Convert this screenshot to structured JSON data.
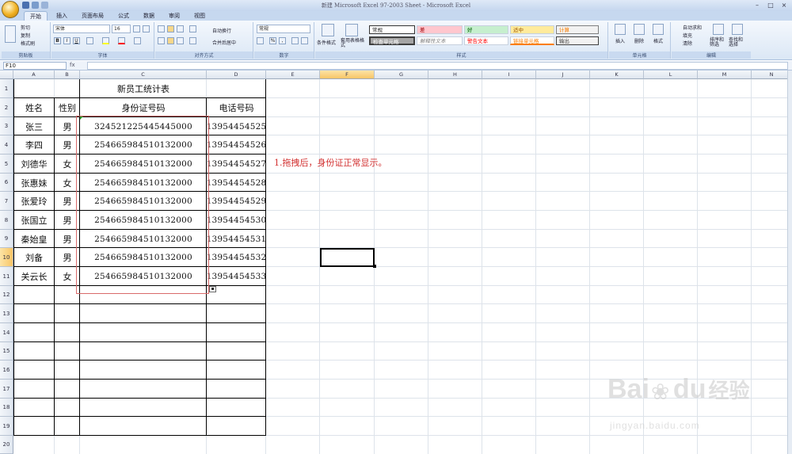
{
  "window": {
    "title": "新建 Microsoft Excel 97-2003 Sheet - Microsoft Excel",
    "controls": [
      "–",
      "□",
      "×"
    ]
  },
  "tabs": [
    "开始",
    "插入",
    "页面布局",
    "公式",
    "数据",
    "审阅",
    "视图"
  ],
  "ribbon": {
    "clipboard": {
      "label": "剪贴板",
      "cut": "剪切",
      "copy": "复制",
      "format_painter": "格式刷"
    },
    "font": {
      "label": "字体",
      "font_name": "宋体",
      "font_size": "16",
      "bold": "B",
      "italic": "I",
      "underline": "U"
    },
    "alignment": {
      "label": "对齐方式",
      "wrap": "自动换行",
      "merge": "合并后居中"
    },
    "number": {
      "label": "数字",
      "format": "常规",
      "percent": "%",
      "comma": ","
    },
    "styles": {
      "label": "样式",
      "conditional": "条件格式",
      "table_format": "套用表格格式",
      "cells": [
        {
          "text": "常规",
          "bg": "#ffffff",
          "color": "#000000"
        },
        {
          "text": "差",
          "bg": "#ffc7ce",
          "color": "#9c0006"
        },
        {
          "text": "好",
          "bg": "#c6efce",
          "color": "#006100"
        },
        {
          "text": "适中",
          "bg": "#ffeb9c",
          "color": "#9c5700"
        },
        {
          "text": "计算",
          "bg": "#f2f2f2",
          "color": "#fa7d00"
        },
        {
          "text": "检查单元格",
          "bg": "#a5a5a5",
          "color": "#ffffff"
        },
        {
          "text": "解释性文本",
          "bg": "#ffffff",
          "color": "#7f7f7f"
        },
        {
          "text": "警告文本",
          "bg": "#ffffff",
          "color": "#ff0000"
        },
        {
          "text": "链接单元格",
          "bg": "#ffffff",
          "color": "#fa7d00"
        },
        {
          "text": "输出",
          "bg": "#f2f2f2",
          "color": "#3f3f3f"
        }
      ]
    },
    "cells_group": {
      "label": "单元格",
      "insert": "插入",
      "delete": "删除",
      "format": "格式"
    },
    "editing": {
      "label": "编辑",
      "autosum": "自动求和",
      "fill": "填充",
      "clear": "清除",
      "sort": "排序和筛选",
      "find": "查找和选择"
    }
  },
  "formula_bar": {
    "name_box": "F10",
    "fx": "fx",
    "content": ""
  },
  "columns": [
    "A",
    "B",
    "C",
    "D",
    "E",
    "F",
    "G",
    "H",
    "I",
    "J",
    "K",
    "L",
    "M",
    "N"
  ],
  "selected_column": "F",
  "rows": [
    "1",
    "2",
    "3",
    "4",
    "5",
    "6",
    "7",
    "8",
    "9",
    "10",
    "11",
    "12",
    "13",
    "14",
    "15",
    "16",
    "17",
    "18",
    "19",
    "20"
  ],
  "selected_row": "10",
  "sheet": {
    "title": "新员工统计表",
    "headers": [
      "姓名",
      "性别",
      "身份证号码",
      "电话号码"
    ],
    "records": [
      [
        "张三",
        "男",
        "324521225445445000",
        "13954454525"
      ],
      [
        "李四",
        "男",
        "254665984510132000",
        "13954454526"
      ],
      [
        "刘德华",
        "女",
        "254665984510132000",
        "13954454527"
      ],
      [
        "张惠妹",
        "女",
        "254665984510132000",
        "13954454528"
      ],
      [
        "张爱玲",
        "男",
        "254665984510132000",
        "13954454529"
      ],
      [
        "张国立",
        "男",
        "254665984510132000",
        "13954454530"
      ],
      [
        "秦始皇",
        "男",
        "254665984510132000",
        "13954454531"
      ],
      [
        "刘备",
        "男",
        "254665984510132000",
        "13954454532"
      ],
      [
        "关云长",
        "女",
        "254665984510132000",
        "13954454533"
      ]
    ],
    "note": "1.拖拽后，身份证正常显示。"
  },
  "watermark": {
    "brand": "Bai",
    "brand2": "du",
    "cn": "经验",
    "url": "jingyan.baidu.com"
  }
}
